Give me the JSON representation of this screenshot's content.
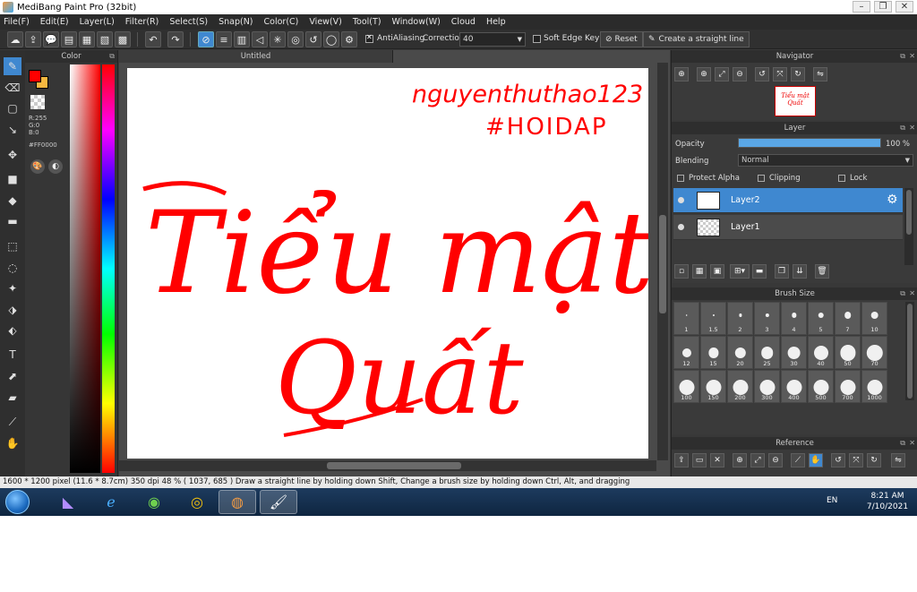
{
  "window": {
    "title": "MediBang Paint Pro (32bit)",
    "controls": [
      "–",
      "❐",
      "✕"
    ]
  },
  "menu": [
    "File(F)",
    "Edit(E)",
    "Layer(L)",
    "Filter(R)",
    "Select(S)",
    "Snap(N)",
    "Color(C)",
    "View(V)",
    "Tool(T)",
    "Window(W)",
    "Cloud",
    "Help"
  ],
  "toolbar": {
    "antialiasing_label": "AntiAliasing",
    "antialiasing_checked": true,
    "correction_label": "Correction",
    "correction_value": "40",
    "soft_edge_label": "Soft Edge",
    "soft_edge_checked": false,
    "key_label": "Key",
    "reset_label": "Reset",
    "straight_line_label": "Create a straight line"
  },
  "color_panel": {
    "title": "Color",
    "fg_color": "#ff0000",
    "bg_color": "#f6b840",
    "r": "R:255",
    "g": "G:0",
    "b": "B:0",
    "hex": "#FF0000"
  },
  "document": {
    "tab_title": "Untitled",
    "username_text": "nguyenthuthao123",
    "hashtag_text": "#HOIDAP",
    "line1": "Tiểu mật",
    "line2": "Quất",
    "ink_color": "#ff0000"
  },
  "navigator": {
    "title": "Navigator",
    "thumb_line1": "Tiểu mật",
    "thumb_line2": "Quất"
  },
  "layer_panel": {
    "title": "Layer",
    "opacity_label": "Opacity",
    "opacity_value": 100,
    "opacity_text": "100 %",
    "blending_label": "Blending",
    "blending_value": "Normal",
    "protect_alpha_label": "Protect Alpha",
    "clipping_label": "Clipping",
    "lock_label": "Lock",
    "layers": [
      {
        "name": "Layer2",
        "selected": true
      },
      {
        "name": "Layer1",
        "selected": false
      }
    ]
  },
  "brush_size": {
    "title": "Brush Size",
    "sizes": [
      "1",
      "1.5",
      "2",
      "3",
      "4",
      "5",
      "7",
      "10",
      "12",
      "15",
      "20",
      "25",
      "30",
      "40",
      "50",
      "70",
      "100",
      "150",
      "200",
      "300",
      "400",
      "500",
      "700",
      "1000"
    ]
  },
  "reference": {
    "title": "Reference"
  },
  "status": {
    "text": "1600 * 1200 pixel   (11.6 * 8.7cm)  350 dpi  48 %   ( 1037, 685 )   Draw a straight line by holding down Shift, Change a brush size by holding down Ctrl, Alt, and dragging"
  },
  "taskbar": {
    "lang": "EN",
    "time": "8:21 AM",
    "date": "7/10/2021"
  }
}
